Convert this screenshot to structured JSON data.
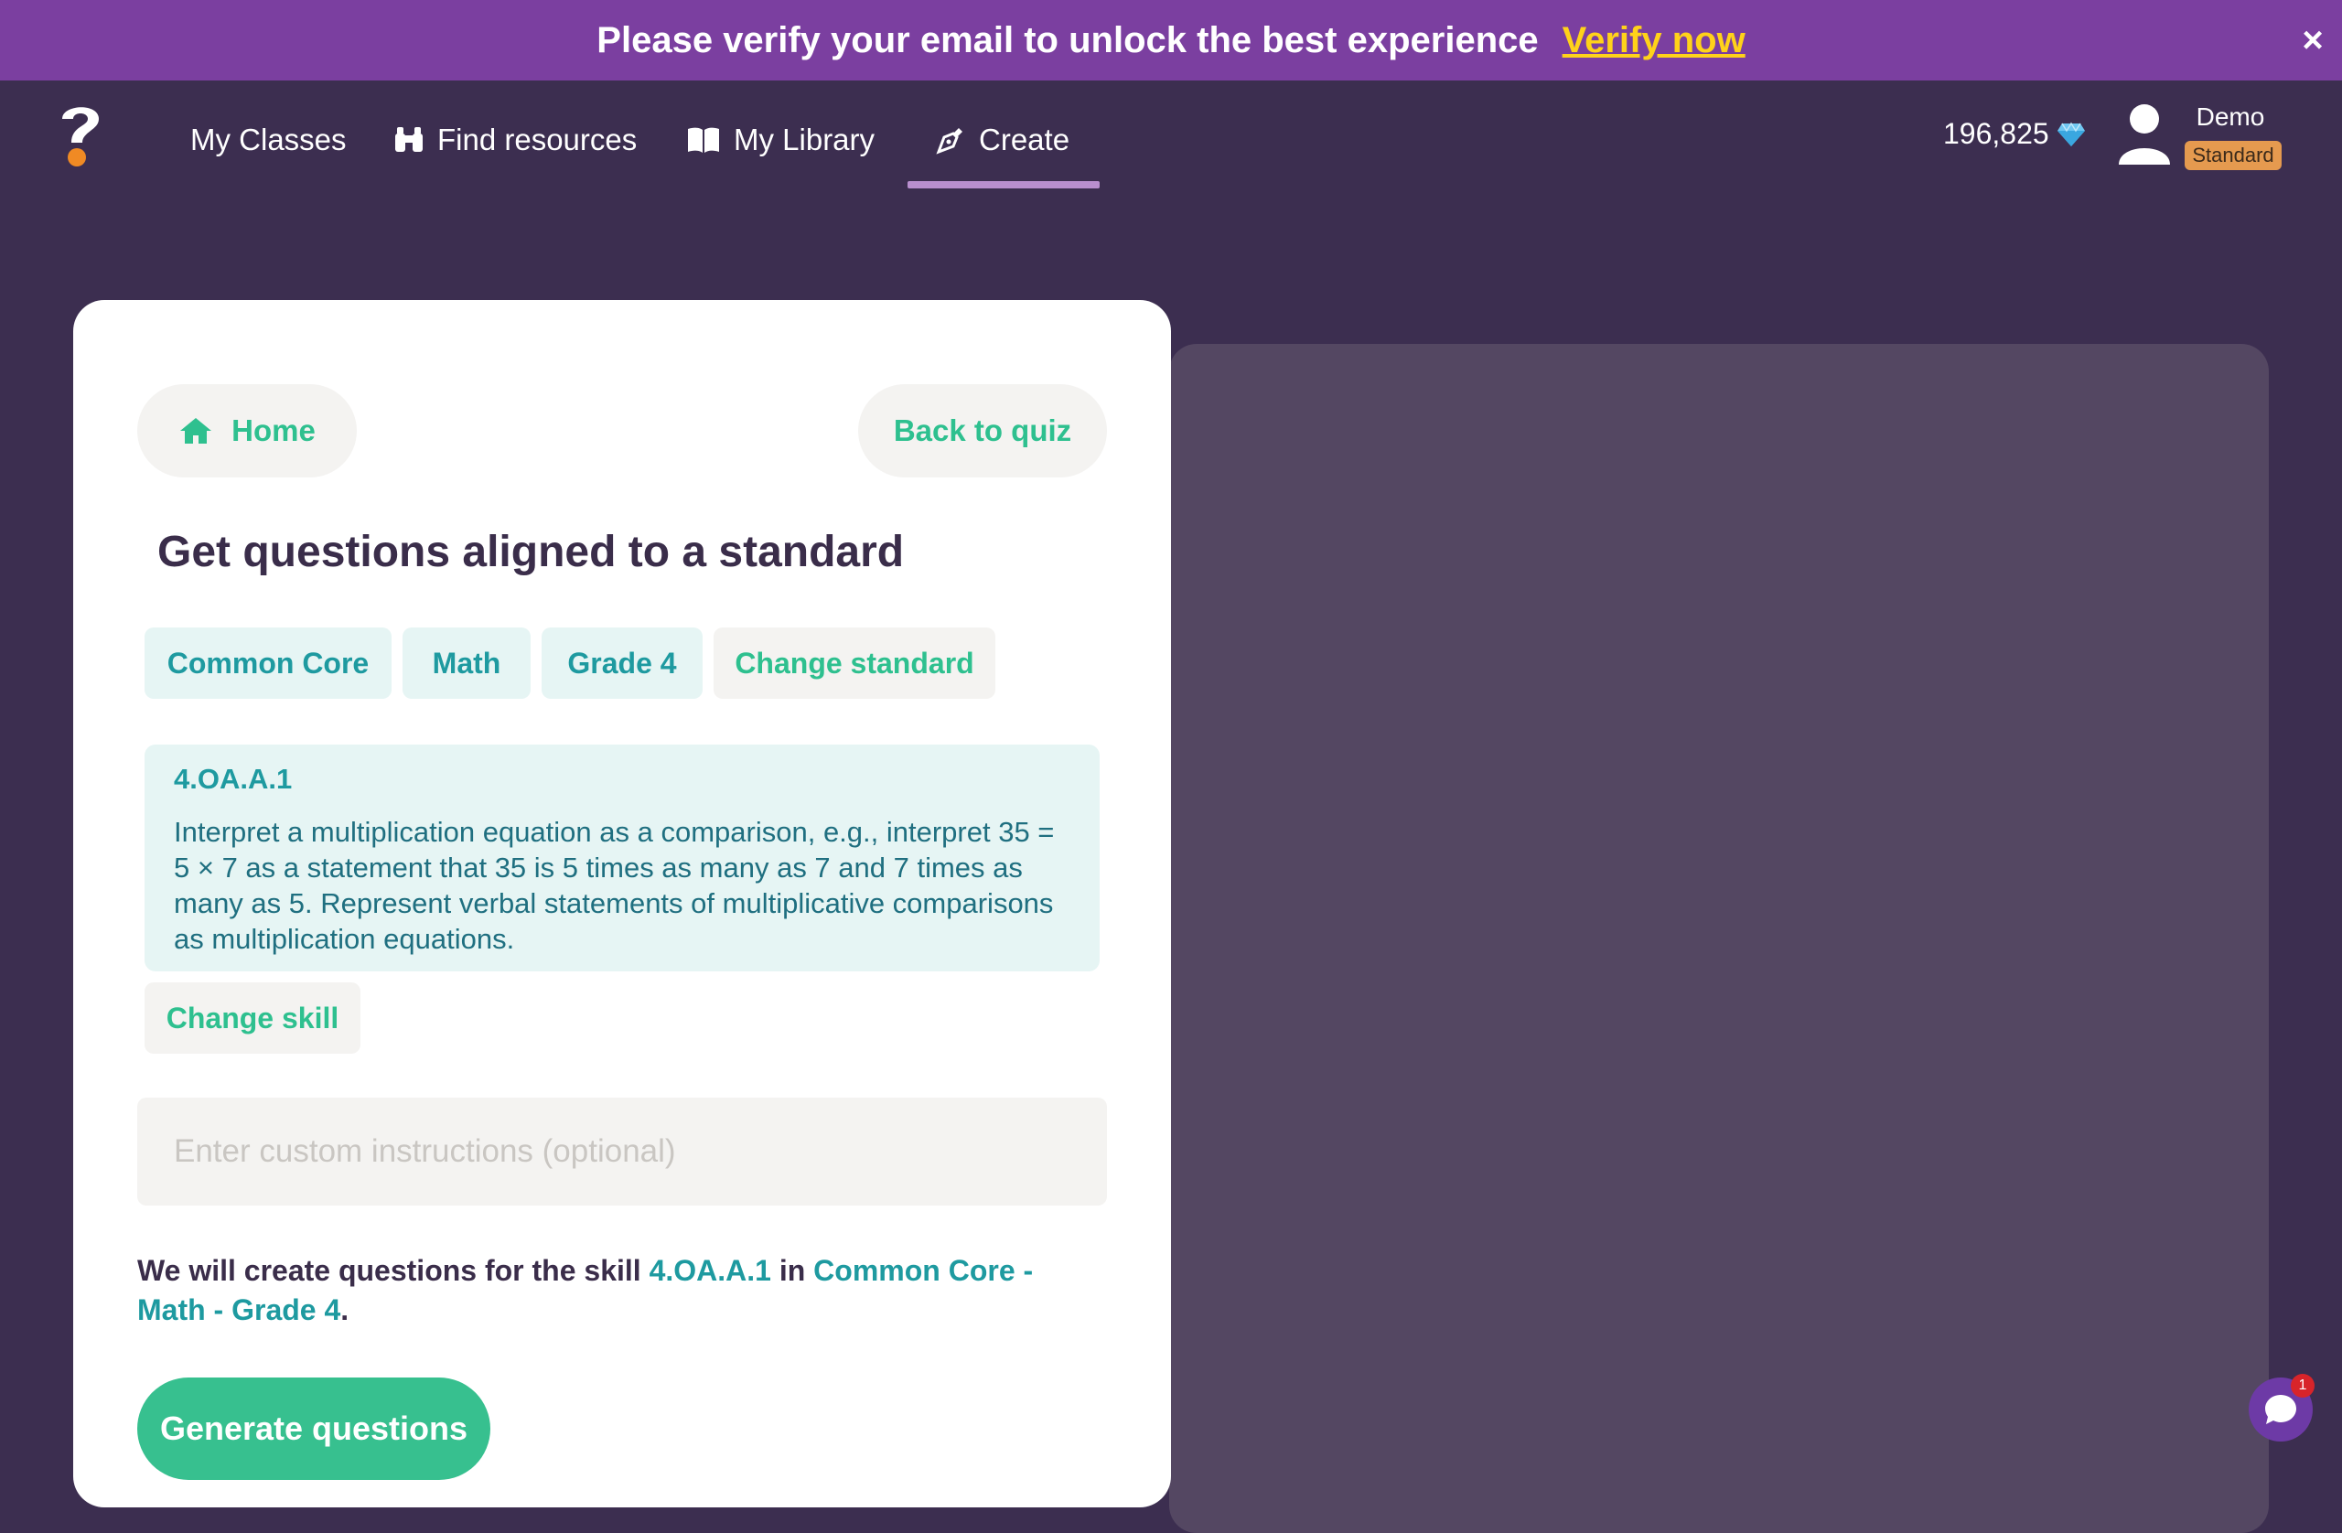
{
  "banner": {
    "message": "Please verify your email to unlock the best experience",
    "link": "Verify now",
    "close": "×"
  },
  "nav": {
    "items": [
      {
        "label": "My Classes"
      },
      {
        "label": "Find resources"
      },
      {
        "label": "My Library"
      },
      {
        "label": "Create"
      }
    ],
    "active": "Create",
    "gems": "196,825",
    "user_name": "Demo",
    "plan": "Standard"
  },
  "card": {
    "home_label": "Home",
    "back_label": "Back to quiz",
    "heading": "Get questions aligned to a standard",
    "chips": [
      "Common Core",
      "Math",
      "Grade 4",
      "Change standard"
    ],
    "skill_code": "4.OA.A.1",
    "skill_description": "Interpret a multiplication equation as a comparison, e.g., interpret 35 = 5 × 7 as a statement that 35 is 5 times as many as 7 and 7 times as many as 5. Represent verbal statements of multiplicative comparisons as multiplication equations.",
    "change_skill_label": "Change skill",
    "instructions_placeholder": "Enter custom instructions (optional)",
    "instructions_value": "",
    "summary": {
      "prefix": "We will create questions for the skill ",
      "skill": "4.OA.A.1",
      "middle": " in ",
      "standard": "Common Core - Math - Grade 4",
      "suffix": "."
    },
    "generate_label": "Generate questions"
  },
  "chat": {
    "badge_count": "1"
  },
  "colors": {
    "background": "#3c2e50",
    "banner": "#7b3fa0",
    "accent_green": "#37c08f",
    "accent_teal": "#1e9aa0",
    "verify_yellow": "#ffd21a",
    "badge_orange": "#e59a4f"
  },
  "icons": {
    "logo": "quizizz-logo-icon",
    "find": "binoculars-icon",
    "library": "book-icon",
    "create": "pen-nib-icon",
    "gem": "diamond-icon",
    "avatar": "user-icon",
    "home": "home-icon",
    "chat": "chat-bubble-icon"
  }
}
